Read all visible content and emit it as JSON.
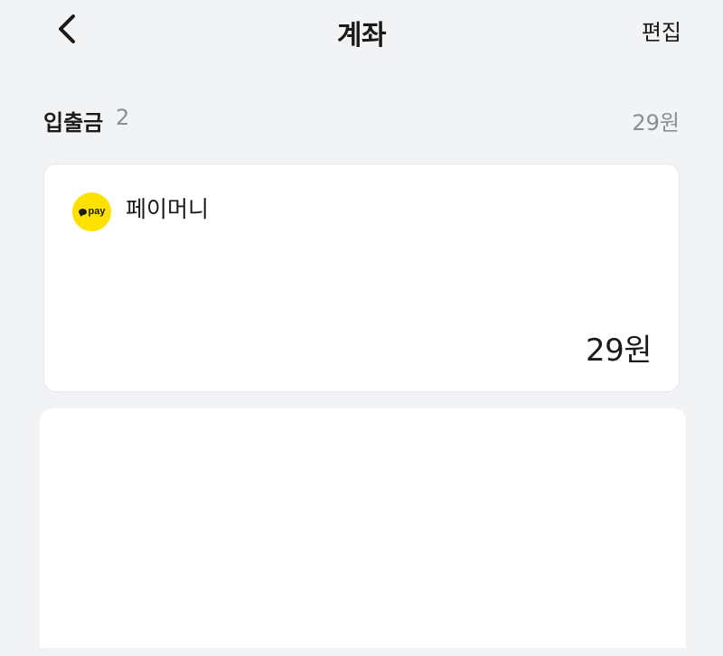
{
  "header": {
    "title": "계좌",
    "edit_label": "편집",
    "back_icon": "chevron-left-icon"
  },
  "section": {
    "title": "입출금",
    "count": "2",
    "total": "29원"
  },
  "accounts": [
    {
      "logo_icon": "kakaopay-logo-icon",
      "logo_text": "pay",
      "logo_color": "#ffe100",
      "name": "페이머니",
      "balance": "29원"
    }
  ],
  "colors": {
    "background": "#f2f3f5",
    "card": "#ffffff",
    "muted_text": "#8a8f96",
    "primary_text": "#1a1a1a"
  }
}
